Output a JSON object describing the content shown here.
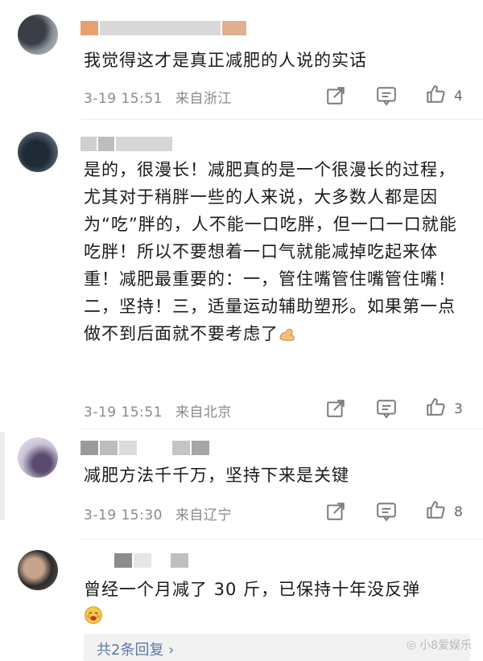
{
  "comments": [
    {
      "name": "·说我没有账号",
      "text": "我觉得这才是真正减肥的人说的实话",
      "date": "3-19 15:51",
      "location": "来自浙江",
      "likes": "4"
    },
    {
      "name": "░░░░░",
      "text": "是的，很漫长！减肥真的是一个很漫长的过程，尤其对于稍胖一些的人来说，大多数人都是因为“吃”胖的，人不能一口吃胖，但一口一口就能吃胖！所以不要想着一口气就能减掉吃起来体重！减肥最重要的：一，管住嘴管住嘴管住嘴！二，坚持！三，适量运动辅助塑形。如果第一点做不到后面就不要考虑了",
      "date": "3-19 15:51",
      "location": "来自北京",
      "likes": "3"
    },
    {
      "name": "",
      "text": "减肥方法千千万，坚持下来是关键",
      "date": "3-19 15:30",
      "location": "来自辽宁",
      "likes": "8"
    },
    {
      "name": "",
      "text": "曾经一个月减了 30 斤，已保持十年没反弹",
      "reply_link": "共2条回复 ›"
    }
  ],
  "watermark": "小8爱娱乐",
  "icons": {
    "share": "share-icon",
    "comment": "comment-icon",
    "like": "thumbs-up-icon",
    "flex_emoji": "flexed-biceps-emoji",
    "hot_face_emoji": "face-emoji"
  },
  "colors": {
    "meta_text": "#8a8a8a",
    "reply_link": "#5b7ba6",
    "divider": "#ececec"
  }
}
